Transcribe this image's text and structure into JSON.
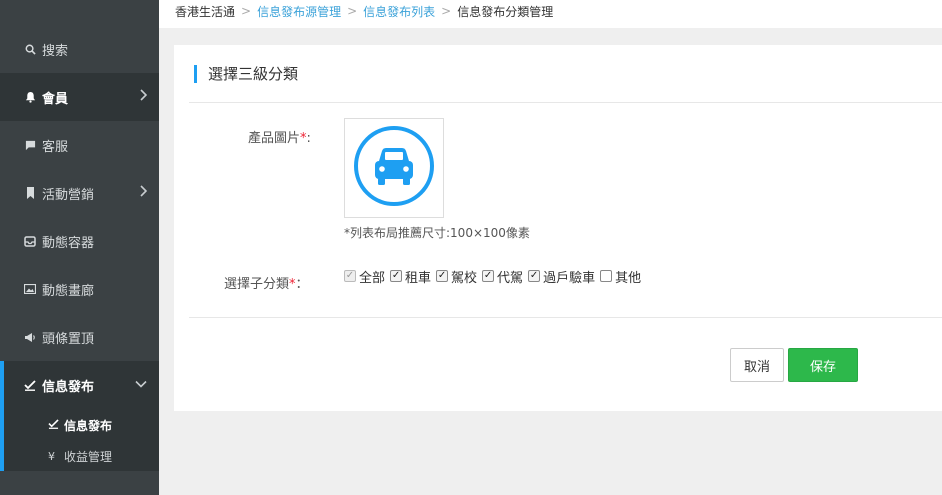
{
  "sidebar": {
    "items": [
      {
        "label": "搜索",
        "icon": "search-icon"
      },
      {
        "label": "會員",
        "icon": "bell-icon"
      },
      {
        "label": "客服",
        "icon": "chat-icon"
      },
      {
        "label": "活動營銷",
        "icon": "bookmark-icon"
      },
      {
        "label": "動態容器",
        "icon": "inbox-icon"
      },
      {
        "label": "動態畫廊",
        "icon": "image-icon"
      },
      {
        "label": "頭條置頂",
        "icon": "megaphone-icon"
      },
      {
        "label": "信息發布",
        "icon": "check-edit-icon"
      }
    ],
    "sub_items": [
      {
        "label": "信息發布",
        "icon": "check-edit-icon"
      },
      {
        "label": "收益管理",
        "icon": "yen-icon"
      }
    ]
  },
  "breadcrumb": {
    "items": [
      "香港生活通",
      "信息發布源管理",
      "信息發布列表",
      "信息發布分類管理"
    ]
  },
  "panel": {
    "title": "選擇三級分類",
    "image_label": "產品圖片",
    "image_hint": "*列表布局推薦尺寸:100×100像素",
    "image_icon": "car-icon",
    "subcat_label": "選擇子分類",
    "required_mark": "*",
    "label_suffix": ":",
    "subcat_suffix": "：",
    "checkboxes": [
      {
        "label": "全部",
        "checked": true,
        "disabled": true
      },
      {
        "label": "租車",
        "checked": true
      },
      {
        "label": "駕校",
        "checked": true
      },
      {
        "label": "代駕",
        "checked": true
      },
      {
        "label": "過戶驗車",
        "checked": true
      },
      {
        "label": "其他",
        "checked": false
      }
    ]
  },
  "buttons": {
    "cancel": "取消",
    "save": "保存"
  },
  "colors": {
    "accent": "#1e9ff2",
    "save_green": "#2db84b",
    "sidebar_bg": "#3b4144"
  }
}
